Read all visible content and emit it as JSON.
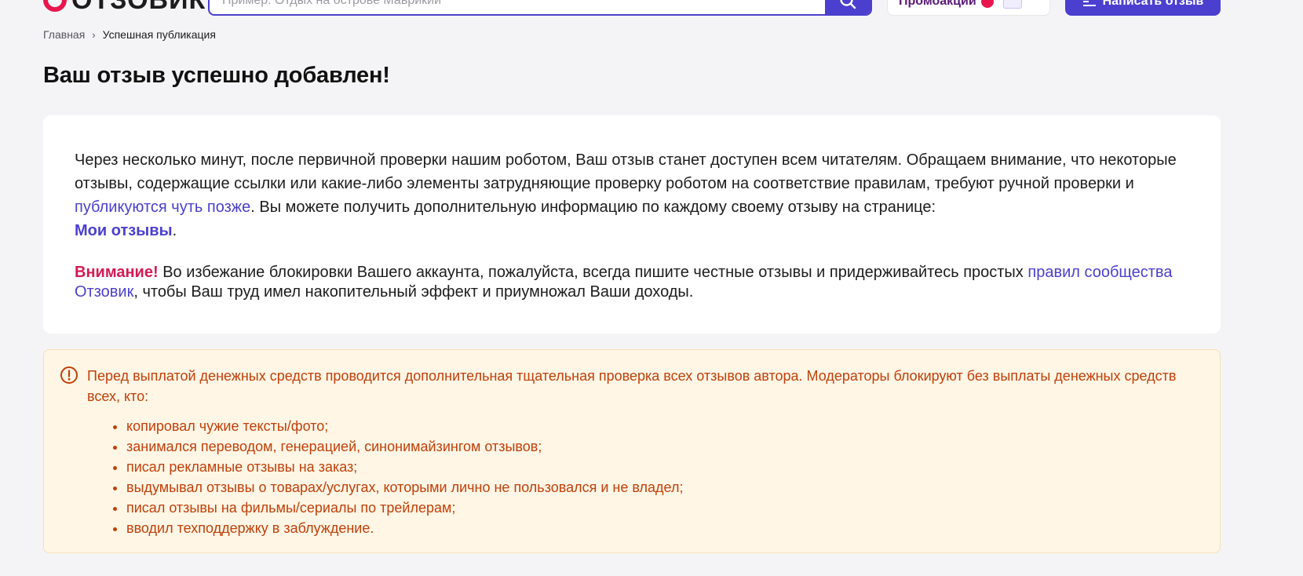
{
  "header": {
    "logo_text": "ОТЗОВИК",
    "search_placeholder": "Пример: Отдых на острове Маврикий",
    "promo_label": "Промоакции",
    "write_label": "Написать отзыв"
  },
  "breadcrumb": {
    "home": "Главная",
    "separator": "›",
    "current": "Успешная публикация"
  },
  "title": "Ваш отзыв успешно добавлен!",
  "info": {
    "para1_part1": "Через несколько минут, после первичной проверки нашим роботом, Ваш отзыв станет доступен всем читателям. Обращаем внимание, что некоторые отзывы, содержащие ссылки или какие-либо элементы затрудняющие проверку роботом на соответствие правилам, требуют ручной проверки и ",
    "para1_link": "публикуются чуть позже",
    "para1_part2": ". Вы можете получить дополнительную информацию по каждому своему отзыву на странице: ",
    "my_reviews_link": "Мои отзывы",
    "para1_end": ".",
    "attention_label": "Внимание!",
    "para2_part1": " Во избежание блокировки Вашего аккаунта, пожалуйста, всегда пишите честные отзывы и придерживайтесь простых ",
    "rules_link": "правил сообщества Отзовик",
    "para2_part2": ", чтобы Ваш труд имел накопительный эффект и приумножал Ваши доходы."
  },
  "notice": {
    "text": "Перед выплатой денежных средств проводится дополнительная тщательная проверка всех отзывов автора. Модераторы блокируют без выплаты денежных средств всех, кто:",
    "items": [
      "копировал чужие тексты/фото;",
      "занимался переводом, генерацией, синонимайзингом отзывов;",
      "писал рекламные отзывы на заказ;",
      "выдумывал отзывы о товарах/услугах, которыми лично не пользовался и не владел;",
      "писал отзывы на фильмы/сериалы по трейлерам;",
      "вводил техподдержку в заблуждение."
    ]
  },
  "colors": {
    "brand_red": "#e8164d",
    "accent_blue": "#4b3fcf",
    "attention": "#d41a55",
    "notice_text": "#c1400a",
    "notice_bg": "#fff6e5"
  },
  "icons": {
    "search": "search-icon",
    "notice": "exclamation-circle-icon",
    "write": "list-pen-icon"
  }
}
